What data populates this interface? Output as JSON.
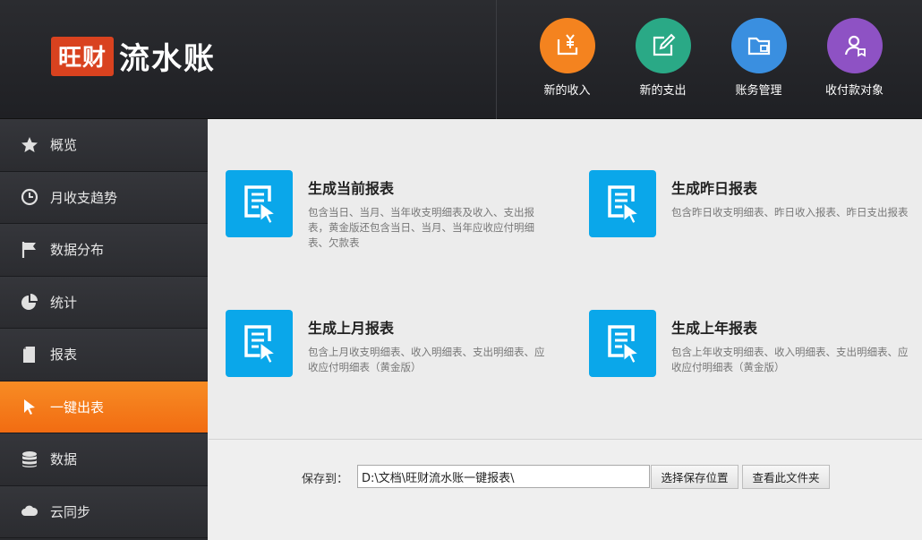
{
  "logo": {
    "badge": "旺财",
    "name": "流水账"
  },
  "actions": [
    {
      "label": "新的收入",
      "color": "#f4831f",
      "icon": "income-icon"
    },
    {
      "label": "新的支出",
      "color": "#2aa986",
      "icon": "edit-icon"
    },
    {
      "label": "账务管理",
      "color": "#3a8fe0",
      "icon": "folder-icon"
    },
    {
      "label": "收付款对象",
      "color": "#8e52c4",
      "icon": "contact-icon"
    }
  ],
  "sidebar": {
    "items": [
      {
        "label": "概览",
        "icon": "star-icon"
      },
      {
        "label": "月收支趋势",
        "icon": "clock-icon"
      },
      {
        "label": "数据分布",
        "icon": "flag-icon"
      },
      {
        "label": "统计",
        "icon": "pie-icon"
      },
      {
        "label": "报表",
        "icon": "document-icon"
      },
      {
        "label": "一键出表",
        "icon": "cursor-icon",
        "active": true
      },
      {
        "label": "数据",
        "icon": "database-icon"
      },
      {
        "label": "云同步",
        "icon": "cloud-icon"
      }
    ]
  },
  "reports": [
    {
      "title": "生成当前报表",
      "desc": "包含当日、当月、当年收支明细表及收入、支出报表，黄金版还包含当日、当月、当年应收应付明细表、欠款表"
    },
    {
      "title": "生成昨日报表",
      "desc": "包含昨日收支明细表、昨日收入报表、昨日支出报表"
    },
    {
      "title": "生成上月报表",
      "desc": "包含上月收支明细表、收入明细表、支出明细表、应收应付明细表（黄金版）"
    },
    {
      "title": "生成上年报表",
      "desc": "包含上年收支明细表、收入明细表、支出明细表、应收应付明细表（黄金版）"
    }
  ],
  "footer": {
    "save_label": "保存到：",
    "path_value": "D:\\文档\\旺财流水账一键报表\\",
    "choose_button": "选择保存位置",
    "view_button": "查看此文件夹"
  },
  "colors": {
    "accent": "#f47a1b",
    "report_icon": "#0aa7ea"
  }
}
